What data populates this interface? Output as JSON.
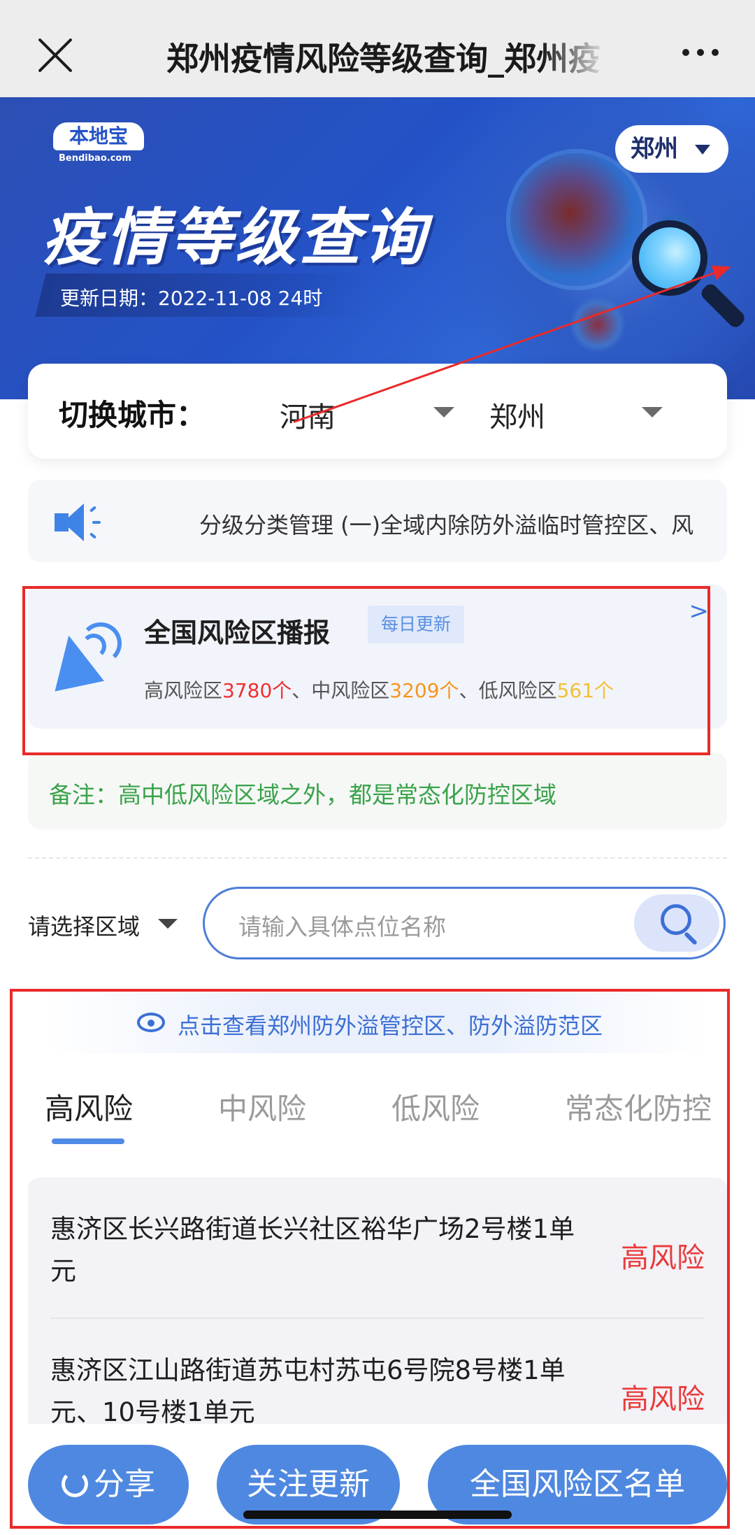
{
  "navbar": {
    "title": "郑州疫情风险等级查询_郑州疫"
  },
  "banner": {
    "logo_main": "本地宝",
    "logo_sub": "Bendibao.com",
    "title": "疫情等级查询",
    "update_date": "更新日期：2022-11-08 24时",
    "city_badge": "郑州"
  },
  "switch_city": {
    "label": "切换城市：",
    "province": "河南",
    "city": "郑州"
  },
  "notice": {
    "text": "分级分类管理 (一)全域内除防外溢临时管控区、风"
  },
  "broadcast": {
    "title": "全国风险区播报",
    "tag": "每日更新",
    "arrow": ">",
    "high_label": "高风险区",
    "high_count": "3780个",
    "sep1": "、中风险区",
    "mid_count": "3209个",
    "sep2": "、低风险区",
    "low_count": "561个"
  },
  "remark": {
    "text": "备注：高中低风险区域之外，都是常态化防控区域"
  },
  "search": {
    "region_label": "请选择区域",
    "placeholder": "请输入具体点位名称"
  },
  "zone_link": {
    "text": "点击查看郑州防外溢管控区、防外溢防范区"
  },
  "tabs": [
    {
      "label": "高风险"
    },
    {
      "label": "中风险"
    },
    {
      "label": "低风险"
    },
    {
      "label": "常态化防控"
    }
  ],
  "list": [
    {
      "address": "惠济区长兴路街道长兴社区裕华广场2号楼1单元",
      "risk": "高风险"
    },
    {
      "address": "惠济区江山路街道苏屯村苏屯6号院8号楼1单元、10号楼1单元",
      "risk": "高风险"
    }
  ],
  "buttons": {
    "share": "分享",
    "follow": "关注更新",
    "list": "全国风险区名单"
  },
  "colors": {
    "accent": "#4f88e0",
    "high": "#ef2f2f",
    "mid": "#f4961e",
    "low": "#f2bf37",
    "remark": "#3aa34a",
    "annotation": "#ea2a2a"
  }
}
